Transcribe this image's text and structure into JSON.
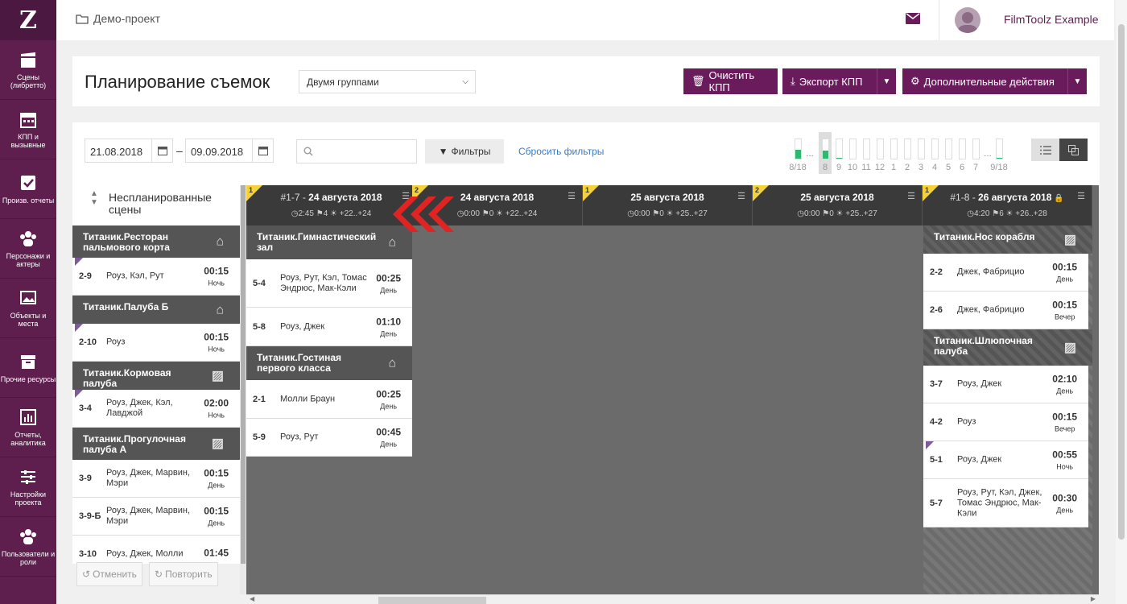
{
  "app": {
    "logo": "Z",
    "project": "Демо-проект",
    "username": "FilmToolz Example"
  },
  "sidebar": [
    {
      "label": "Сцены (либретто)",
      "icon": "clapperboard-icon"
    },
    {
      "label": "КПП и вызывные",
      "icon": "calendar-icon"
    },
    {
      "label": "Произв. отчеты",
      "icon": "checkbox-icon"
    },
    {
      "label": "Персонажи и актеры",
      "icon": "people-icon"
    },
    {
      "label": "Объекты и места",
      "icon": "image-icon"
    },
    {
      "label": "Прочие ресурсы",
      "icon": "archive-icon"
    },
    {
      "label": "Отчеты, аналитика",
      "icon": "bar-chart-icon"
    },
    {
      "label": "Настройки проекта",
      "icon": "sliders-icon"
    },
    {
      "label": "Пользователи и роли",
      "icon": "users-icon"
    }
  ],
  "header": {
    "title": "Планирование съемок",
    "grouping": "Двумя группами",
    "clear_btn": "Очистить КПП",
    "export_btn": "Экспорт КПП",
    "more_btn": "Дополнительные действия"
  },
  "filters": {
    "date_from": "21.08.2018",
    "date_sep": "–",
    "date_to": "09.09.2018",
    "filter_btn": "Фильтры",
    "reset": "Сбросить фильтры"
  },
  "day_strip": [
    {
      "label": "8/18",
      "fill_pct": 45,
      "dots": true
    },
    {
      "label": "8",
      "fill_pct": 40,
      "selected": true
    },
    {
      "label": "9",
      "fill_pct": 5
    },
    {
      "label": "10",
      "fill_pct": 0
    },
    {
      "label": "11",
      "fill_pct": 0
    },
    {
      "label": "12",
      "fill_pct": 0
    },
    {
      "label": "1",
      "fill_pct": 0
    },
    {
      "label": "2",
      "fill_pct": 0
    },
    {
      "label": "3",
      "fill_pct": 0
    },
    {
      "label": "4",
      "fill_pct": 0
    },
    {
      "label": "5",
      "fill_pct": 0
    },
    {
      "label": "6",
      "fill_pct": 0
    },
    {
      "label": "7",
      "fill_pct": 0,
      "dots": true
    },
    {
      "label": "9/18",
      "fill_pct": 5
    }
  ],
  "unscheduled": {
    "title": "Неспланированные сцены",
    "groups": [
      {
        "name": "Титаник.Ресторан пальмового корта",
        "icon": "home-icon",
        "scenes": [
          {
            "num": "2-9",
            "who": "Роуз, Кэл, Рут",
            "dur": "00:15",
            "time": "Ночь",
            "flag": true
          }
        ]
      },
      {
        "name": "Титаник.Палуба Б",
        "icon": "home-icon",
        "scenes": [
          {
            "num": "2-10",
            "who": "Роуз",
            "dur": "00:15",
            "time": "Ночь",
            "flag": true
          }
        ]
      },
      {
        "name": "Титаник.Кормовая палуба",
        "icon": "image-icon",
        "scenes": [
          {
            "num": "3-4",
            "who": "Роуз, Джек, Кэл, Лавджой",
            "dur": "02:00",
            "time": "Ночь",
            "flag": true
          }
        ]
      },
      {
        "name": "Титаник.Прогулочная палуба А",
        "icon": "image-icon",
        "scenes": [
          {
            "num": "3-9",
            "who": "Роуз, Джек, Марвин, Мэри",
            "dur": "00:15",
            "time": "День"
          },
          {
            "num": "3-9-Б",
            "who": "Роуз, Джек, Марвин, Мэри",
            "dur": "00:15",
            "time": "День"
          },
          {
            "num": "3-10",
            "who": "Роуз, Джек, Молли",
            "dur": "01:45",
            "time": ""
          }
        ]
      }
    ],
    "undo": "Отменить",
    "redo": "Повторить"
  },
  "columns": [
    {
      "num": "#1-7",
      "date": "24 августа 2018",
      "badge": "1",
      "time": "2:45",
      "scenes": "4",
      "weather": "+22..+24",
      "lock": false,
      "groups": [
        {
          "name": "Титаник.Гимнастический зал",
          "icon": "home-icon",
          "scenes": [
            {
              "num": "5-4",
              "who": "Роуз, Рут, Кэл, Томас Эндрюс, Мак-Кэли",
              "dur": "00:25",
              "time": "День"
            },
            {
              "num": "5-8",
              "who": "Роуз, Джек",
              "dur": "01:10",
              "time": "День"
            }
          ]
        },
        {
          "name": "Титаник.Гостиная первого класса",
          "icon": "home-icon",
          "scenes": [
            {
              "num": "2-1",
              "who": "Молли Браун",
              "dur": "00:25",
              "time": "День"
            },
            {
              "num": "5-9",
              "who": "Роуз, Рут",
              "dur": "00:45",
              "time": "День"
            }
          ]
        }
      ]
    },
    {
      "num": "",
      "date": "24 августа 2018",
      "badge": "2",
      "time": "0:00",
      "scenes": "0",
      "weather": "+22..+24",
      "groups": []
    },
    {
      "num": "",
      "date": "25 августа 2018",
      "badge": "1",
      "time": "0:00",
      "scenes": "0",
      "weather": "+25..+27",
      "groups": []
    },
    {
      "num": "",
      "date": "25 августа 2018",
      "badge": "2",
      "time": "0:00",
      "scenes": "0",
      "weather": "+25..+27",
      "groups": []
    },
    {
      "num": "#1-8",
      "date": "26 августа 2018",
      "badge": "1",
      "time": "4:20",
      "scenes": "6",
      "weather": "+26..+28",
      "lock": true,
      "hatched": true,
      "groups": [
        {
          "name": "Титаник.Нос корабля",
          "icon": "image-icon",
          "scenes": [
            {
              "num": "2-2",
              "who": "Джек, Фабрицио",
              "dur": "00:15",
              "time": "День"
            },
            {
              "num": "2-6",
              "who": "Джек, Фабрицио",
              "dur": "00:15",
              "time": "Вечер"
            }
          ]
        },
        {
          "name": "Титаник.Шлюпочная палуба",
          "icon": "image-icon",
          "scenes": [
            {
              "num": "3-7",
              "who": "Роуз, Джек",
              "dur": "02:10",
              "time": "День"
            },
            {
              "num": "4-2",
              "who": "Роуз",
              "dur": "00:15",
              "time": "Вечер"
            },
            {
              "num": "5-1",
              "who": "Роуз, Джек",
              "dur": "00:55",
              "time": "Ночь",
              "flag": true
            },
            {
              "num": "5-7",
              "who": "Роуз, Рут, Кэл, Джек, Томас Эндрюс, Мак-Кэли",
              "dur": "00:30",
              "time": "День"
            }
          ]
        }
      ]
    }
  ]
}
